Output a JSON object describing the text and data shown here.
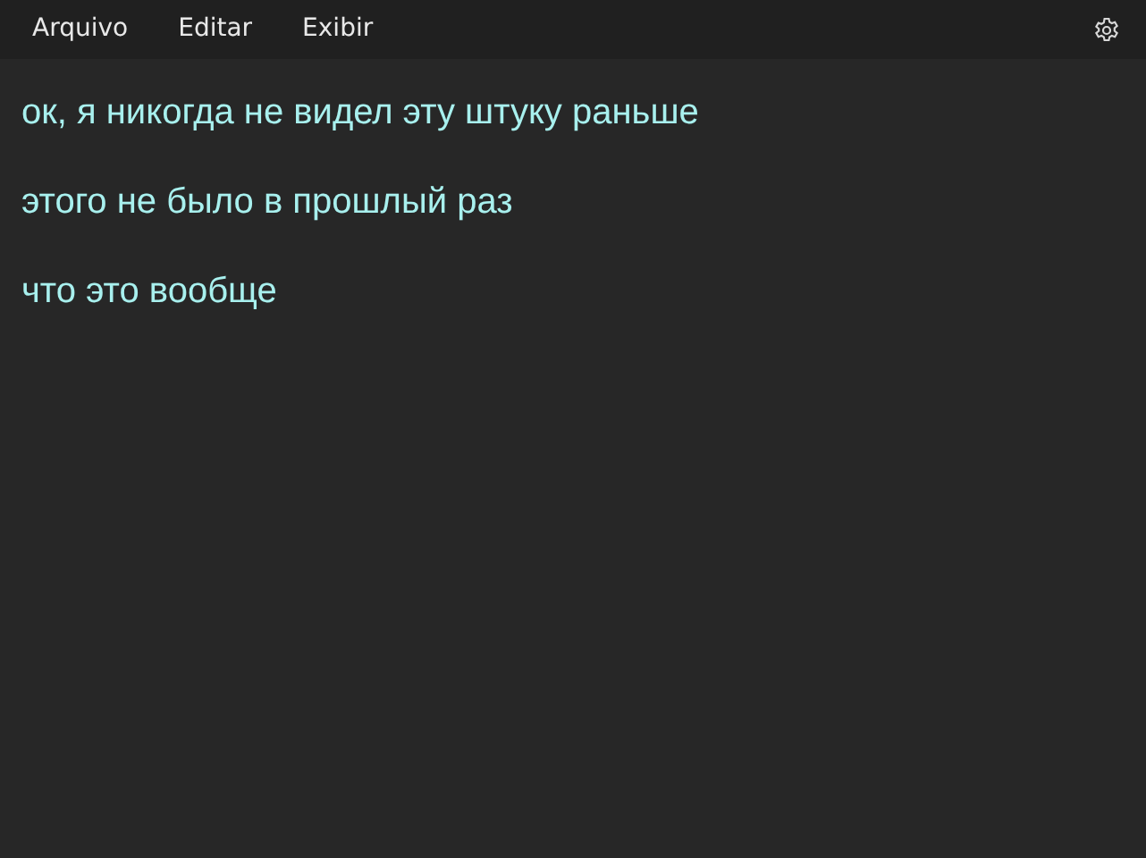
{
  "menu": [
    "Arquivo",
    "Editar",
    "Exibir"
  ],
  "lines": [
    "ок, я никогда не видел эту штуку раньше",
    "этого не было в прошлый раз",
    "что это вообще"
  ]
}
